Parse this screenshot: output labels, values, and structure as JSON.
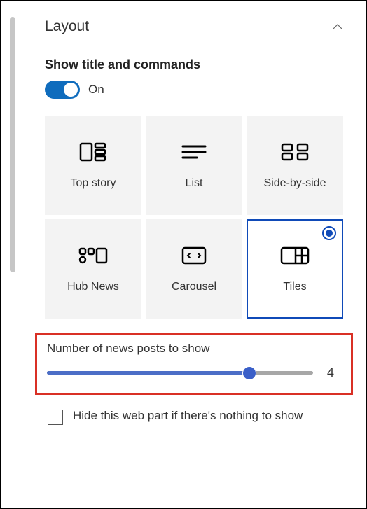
{
  "section": {
    "title": "Layout"
  },
  "toggle": {
    "heading": "Show title and commands",
    "state": "On"
  },
  "layouts": {
    "items": [
      {
        "label": "Top story"
      },
      {
        "label": "List"
      },
      {
        "label": "Side-by-side"
      },
      {
        "label": "Hub News"
      },
      {
        "label": "Carousel"
      },
      {
        "label": "Tiles"
      }
    ],
    "selected": 5
  },
  "slider": {
    "label": "Number of news posts to show",
    "value": "4"
  },
  "checkbox": {
    "label": "Hide this web part if there's nothing to show"
  }
}
